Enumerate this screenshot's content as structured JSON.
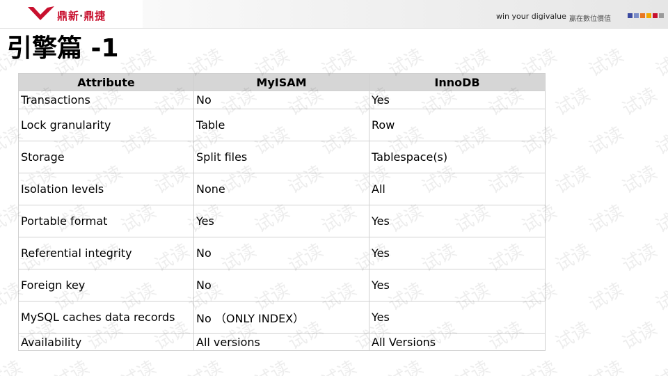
{
  "header": {
    "logo_text": "鼎新",
    "logo_sep": "·",
    "logo_text2": "鼎捷",
    "slogan": "win your digivalue",
    "slogan_cn": "贏在數位價值",
    "squares": [
      "#3b4aa0",
      "#7a8cc8",
      "#e87722",
      "#f2a900",
      "#c8102e",
      "#9a9a9a"
    ]
  },
  "title": "引擎篇 -1",
  "table": {
    "headers": [
      "Attribute",
      "MyISAM",
      "InnoDB"
    ],
    "rows": [
      [
        "Transactions",
        "No",
        "Yes"
      ],
      [
        "Lock granularity",
        "Table",
        "Row"
      ],
      [
        "Storage",
        "Split files",
        "Tablespace(s)"
      ],
      [
        "Isolation levels",
        "None",
        "All"
      ],
      [
        "Portable format",
        "Yes",
        "Yes"
      ],
      [
        "Referential integrity",
        "No",
        "Yes"
      ],
      [
        "Foreign key",
        "No",
        "Yes"
      ],
      [
        "MySQL caches data records",
        "No （ONLY INDEX）",
        "Yes"
      ],
      [
        "Availability",
        "All versions",
        "All Versions"
      ]
    ]
  },
  "watermark_text": "试读"
}
